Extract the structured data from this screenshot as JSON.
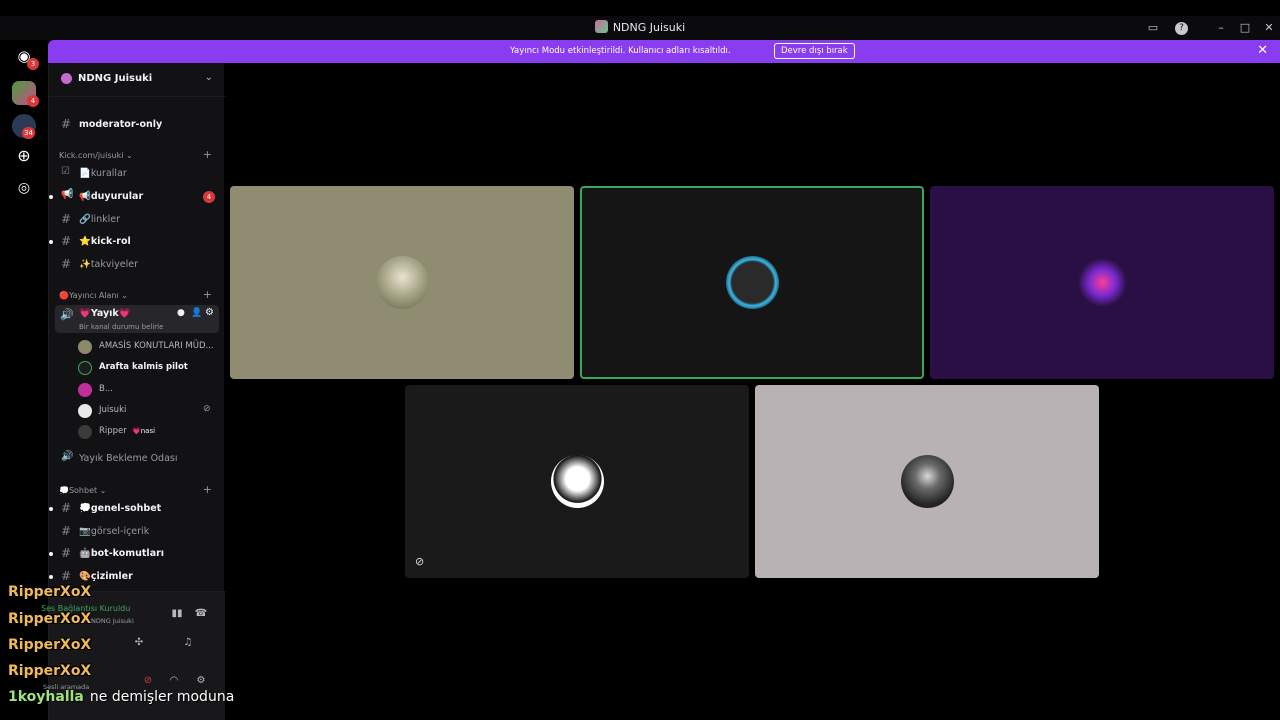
{
  "window": {
    "title": "NDNG Juisuki"
  },
  "banner": {
    "message": "Yayıncı Modu etkinleştirildi. Kullanıcı adları kısaltıldı.",
    "button": "Devre dışı bırak"
  },
  "rail": {
    "badges": [
      "3",
      "4",
      "34"
    ]
  },
  "sidebar": {
    "server_name": "NDNG Juisuki",
    "channels_top": [
      {
        "label": "moderator-only",
        "unread": true
      }
    ],
    "category_kick": "Kick.com/juisuki",
    "channels_kick": [
      {
        "label": "📄kurallar",
        "unread": false
      },
      {
        "label": "📢duyurular",
        "unread": true,
        "badge": "4"
      },
      {
        "label": "🔗linkler",
        "unread": false
      },
      {
        "label": "⭐kick-rol",
        "unread": true
      },
      {
        "label": "✨takviyeler",
        "unread": false
      }
    ],
    "category_stream": "🔴Yayıncı Alanı",
    "voice_channel": {
      "label": "💗Yayık💗",
      "status": "Bir kanal durumu belirle"
    },
    "voice_users": [
      {
        "name": "AMASİS KONUTLARI MÜD...",
        "bold": false
      },
      {
        "name": "Arafta kalmis pilot",
        "bold": true
      },
      {
        "name": "B...",
        "bold": false
      },
      {
        "name": "Juisuki",
        "bold": false
      },
      {
        "name": "Ripper",
        "bold": false,
        "tag": "💗nasi"
      }
    ],
    "waiting_room": "Yayık Bekleme Odası",
    "category_chat": "💭Sohbet",
    "channels_chat": [
      {
        "label": "💭genel-sohbet",
        "unread": true
      },
      {
        "label": "📷görsel-içerik",
        "unread": false
      },
      {
        "label": "🤖bot-komutları",
        "unread": true
      },
      {
        "label": "🎨çizimler",
        "unread": true
      }
    ]
  },
  "panel": {
    "connection": "Ses Bağlantısı Kuruldu",
    "server": "NDNG Juisuki",
    "status": "Sesli aramada"
  },
  "overlay": {
    "names": [
      "RipperXoX",
      "RipperXoX",
      "RipperXoX",
      "RipperXoX"
    ],
    "last_user": "1koyhalla",
    "last_text": "ne demişler moduna"
  },
  "colors": {
    "accent": "#8a3df0",
    "speaking": "#3ba55d",
    "unread_badge": "#da373c"
  }
}
